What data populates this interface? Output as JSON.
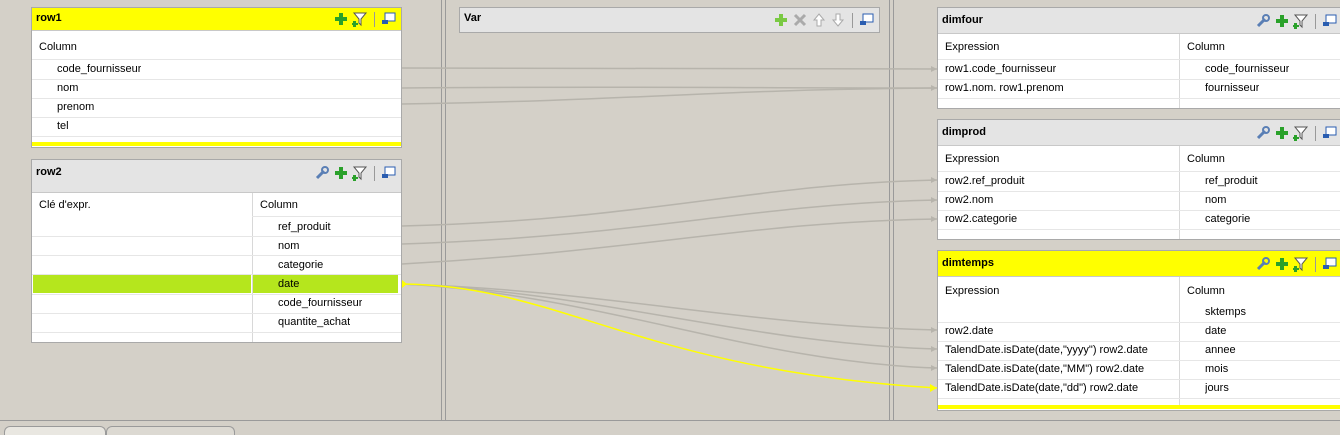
{
  "row1": {
    "title": "row1",
    "column_header": "Column",
    "rows": [
      "code_fournisseur",
      "nom",
      "prenom",
      "tel"
    ]
  },
  "row2": {
    "title": "row2",
    "key_header": "Clé d'expr.",
    "column_header": "Column",
    "rows": [
      "ref_produit",
      "nom",
      "categorie",
      "date",
      "code_fournisseur",
      "quantite_achat"
    ]
  },
  "var": {
    "title": "Var"
  },
  "dimfour": {
    "title": "dimfour",
    "expr_header": "Expression",
    "column_header": "Column",
    "rows": [
      {
        "expr": "row1.code_fournisseur",
        "col": "code_fournisseur"
      },
      {
        "expr": "row1.nom. row1.prenom",
        "col": "fournisseur"
      }
    ]
  },
  "dimprod": {
    "title": "dimprod",
    "expr_header": "Expression",
    "column_header": "Column",
    "rows": [
      {
        "expr": "row2.ref_produit",
        "col": "ref_produit"
      },
      {
        "expr": "row2.nom",
        "col": "nom"
      },
      {
        "expr": "row2.categorie",
        "col": "categorie"
      }
    ]
  },
  "dimtemps": {
    "title": "dimtemps",
    "expr_header": "Expression",
    "column_header": "Column",
    "rows": [
      {
        "expr": "",
        "col": "sktemps"
      },
      {
        "expr": "row2.date",
        "col": "date"
      },
      {
        "expr": "TalendDate.isDate(date,\"yyyy\")  row2.date",
        "col": "annee"
      },
      {
        "expr": "TalendDate.isDate(date,\"MM\")  row2.date",
        "col": "mois"
      },
      {
        "expr": "TalendDate.isDate(date,\"dd\")  row2.date",
        "col": "jours"
      }
    ]
  },
  "colors": {
    "selected_header": "#ffff00",
    "selected_row": "#b5e61d",
    "link": "#b7b4ac",
    "active_link": "#ffff00"
  }
}
